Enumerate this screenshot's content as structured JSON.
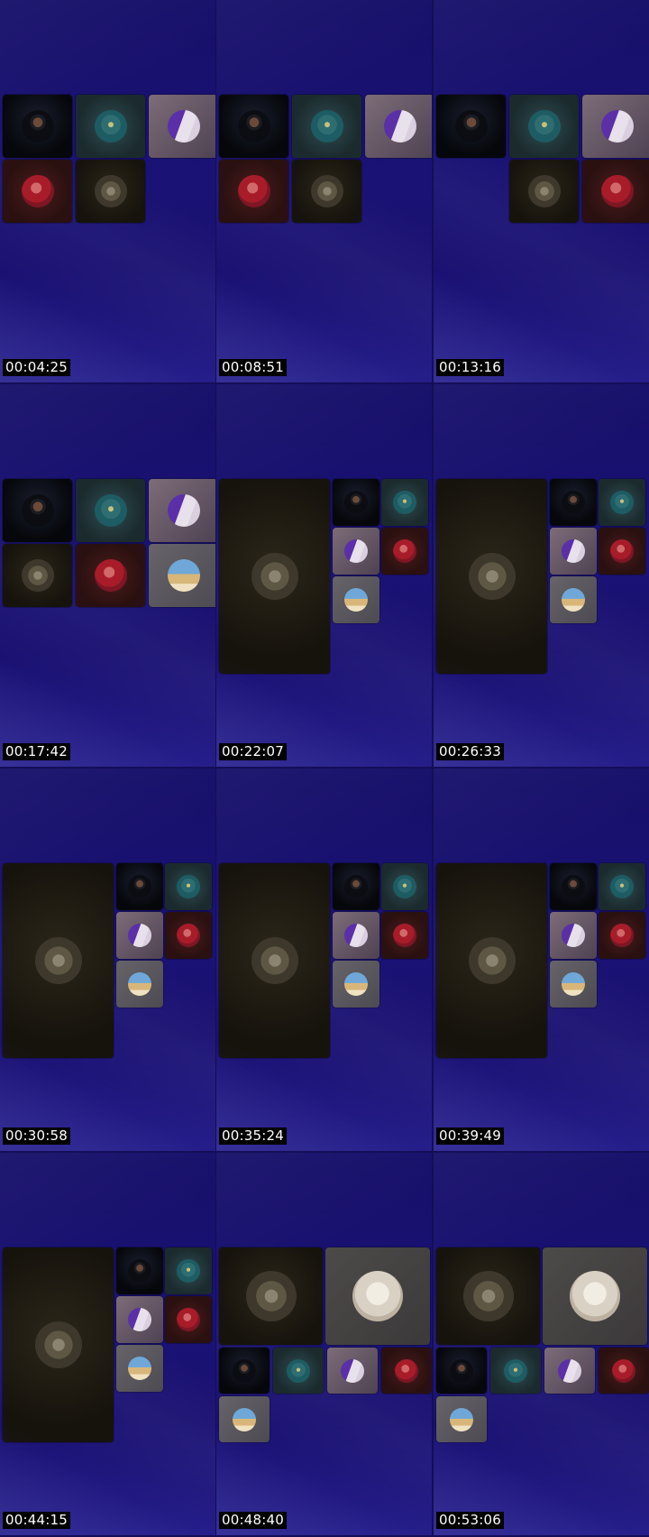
{
  "app": {
    "background_color": "#140e58"
  },
  "tile_colors": {
    "man": "#06070b",
    "alien": "#2f4d52",
    "purple": "#7d6c78",
    "rose": "#4a1c1c",
    "box": "#2b2619",
    "sand": "#666469",
    "white": "#4d4a4a"
  },
  "frames": [
    {
      "timestamp": "00:04:25",
      "layout": "grid-5",
      "participants": [
        "man",
        "alien",
        "purple",
        "rose",
        "box"
      ]
    },
    {
      "timestamp": "00:08:51",
      "layout": "grid-5",
      "participants": [
        "man",
        "alien",
        "purple",
        "rose",
        "box"
      ]
    },
    {
      "timestamp": "00:13:16",
      "layout": "grid-5-shifted",
      "participants": [
        "man",
        "alien",
        "purple",
        "box",
        "rose"
      ]
    },
    {
      "timestamp": "00:17:42",
      "layout": "grid-6",
      "participants": [
        "man",
        "alien",
        "purple",
        "box",
        "rose",
        "sand"
      ]
    },
    {
      "timestamp": "00:22:07",
      "layout": "spotlight",
      "spotlight": "box",
      "participants": [
        "man",
        "alien",
        "purple",
        "rose",
        "sand"
      ]
    },
    {
      "timestamp": "00:26:33",
      "layout": "spotlight",
      "spotlight": "box",
      "participants": [
        "man",
        "alien",
        "purple",
        "rose",
        "sand"
      ]
    },
    {
      "timestamp": "00:30:58",
      "layout": "spotlight",
      "spotlight": "box",
      "participants": [
        "man",
        "alien",
        "purple",
        "rose",
        "sand"
      ]
    },
    {
      "timestamp": "00:35:24",
      "layout": "spotlight",
      "spotlight": "box",
      "participants": [
        "man",
        "alien",
        "purple",
        "rose",
        "sand"
      ]
    },
    {
      "timestamp": "00:39:49",
      "layout": "spotlight",
      "spotlight": "box",
      "participants": [
        "man",
        "alien",
        "purple",
        "rose",
        "sand"
      ]
    },
    {
      "timestamp": "00:44:15",
      "layout": "spotlight",
      "spotlight": "box",
      "participants": [
        "man",
        "alien",
        "purple",
        "rose",
        "sand"
      ]
    },
    {
      "timestamp": "00:48:40",
      "layout": "dual-spotlight",
      "spotlight": [
        "box",
        "white"
      ],
      "participants": [
        "man",
        "alien",
        "purple",
        "rose",
        "sand"
      ]
    },
    {
      "timestamp": "00:53:06",
      "layout": "dual-spotlight",
      "spotlight": [
        "box",
        "white"
      ],
      "participants": [
        "man",
        "alien",
        "purple",
        "rose",
        "sand"
      ]
    }
  ]
}
